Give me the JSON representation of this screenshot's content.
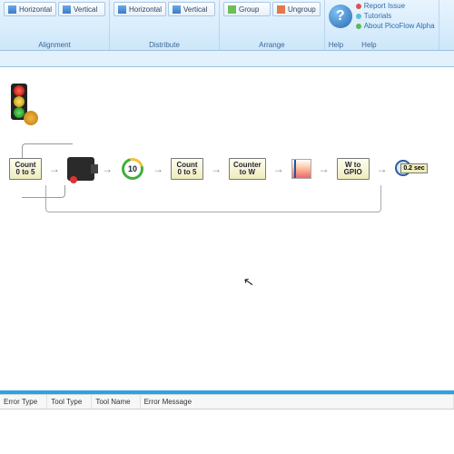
{
  "ribbon": {
    "alignment": {
      "label": "Alignment",
      "horizontal": "Horizontal",
      "vertical": "Vertical"
    },
    "distribute": {
      "label": "Distribute",
      "horizontal": "Horizontal",
      "vertical": "Vertical"
    },
    "arrange": {
      "label": "Arrange",
      "group": "Group",
      "ungroup": "Ungroup"
    },
    "help": {
      "label": "Help",
      "big_label": "Help",
      "report": "Report Issue",
      "tutorials": "Tutorials",
      "about": "About PicoFlow Alpha"
    }
  },
  "flow": {
    "count1": {
      "line1": "Count",
      "line2": "0 to 5"
    },
    "cycle_num": "10",
    "count2": {
      "line1": "Count",
      "line2": "0 to 5"
    },
    "counter": {
      "line1": "Counter",
      "line2": "to W"
    },
    "wgpio": {
      "line1": "W to",
      "line2": "GPIO"
    },
    "timer": "0.2 sec"
  },
  "errors": {
    "cols": {
      "error_type": "Error Type",
      "tool_type": "Tool Type",
      "tool_name": "Tool Name",
      "error_message": "Error Message"
    }
  }
}
